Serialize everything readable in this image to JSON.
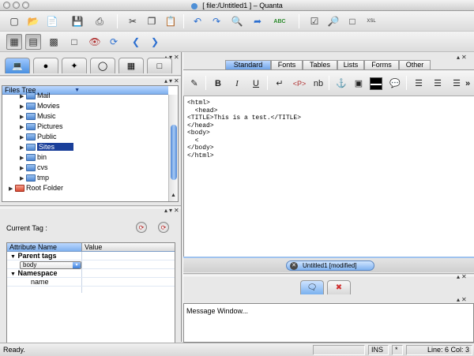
{
  "window": {
    "title": "[  file:/Untitled1  ]  – Quanta"
  },
  "toolbar_main": {
    "icons": [
      "new-icon",
      "open-icon",
      "open-recent-icon",
      "save-icon",
      "print-icon",
      "cut-icon",
      "copy-icon",
      "paste-icon",
      "undo-icon",
      "redo-icon",
      "find-icon",
      "preview-icon",
      "spellcheck-icon",
      "checkbox-icon",
      "zoom-icon",
      "page-icon",
      "xsl-icon"
    ],
    "spell_label": "ABC",
    "xsl_label": "XSL"
  },
  "toolbar_secondary": {
    "icons": [
      "tree-view-icon",
      "page-view-icon",
      "split-view-icon",
      "blank-page-icon",
      "eye-icon",
      "reload-icon",
      "back-icon",
      "forward-icon"
    ]
  },
  "left_panel": {
    "tabs": [
      "project-tab",
      "components-tab",
      "templates-tab",
      "docs-tab",
      "scripts-tab",
      "structure-tab"
    ],
    "files_tree": {
      "header": "Files Tree",
      "items": [
        {
          "label": "Mail",
          "indent": 2,
          "selected": false,
          "red": false
        },
        {
          "label": "Movies",
          "indent": 2,
          "selected": false,
          "red": false
        },
        {
          "label": "Music",
          "indent": 2,
          "selected": false,
          "red": false
        },
        {
          "label": "Pictures",
          "indent": 2,
          "selected": false,
          "red": false
        },
        {
          "label": "Public",
          "indent": 2,
          "selected": false,
          "red": false
        },
        {
          "label": "Sites",
          "indent": 2,
          "selected": true,
          "red": false
        },
        {
          "label": "bin",
          "indent": 2,
          "selected": false,
          "red": false
        },
        {
          "label": "cvs",
          "indent": 2,
          "selected": false,
          "red": false
        },
        {
          "label": "tmp",
          "indent": 2,
          "selected": false,
          "red": false
        },
        {
          "label": "Root Folder",
          "indent": 1,
          "selected": false,
          "red": true
        }
      ]
    },
    "current_tag_label": "Current Tag :",
    "attribute_table": {
      "col_name": "Attribute Name",
      "col_value": "Value",
      "parent_tags_label": "Parent tags",
      "parent_tag_value": "body",
      "namespace_label": "Namespace",
      "name_label": "name"
    }
  },
  "right_panel": {
    "tabs": [
      "Standard",
      "Fonts",
      "Tables",
      "Lists",
      "Forms",
      "Other"
    ],
    "active_tab": "Standard",
    "quickbar": {
      "bold": "B",
      "italic": "I",
      "underline": "U",
      "paragraph": "<P>",
      "nbsp": "nb",
      "more": "»"
    },
    "editor_lines": [
      "<html>",
      "  <head>",
      "<TITLE>This is a test.</TITLE>",
      "</head>",
      "<body>",
      "  <",
      "</body>",
      "</html>"
    ],
    "document_tab": "Untitled1 [modified]",
    "message_window": "Message Window..."
  },
  "statusbar": {
    "status": "Ready.",
    "mode": "INS",
    "modified": "*",
    "position": "Line: 6 Col: 3"
  }
}
